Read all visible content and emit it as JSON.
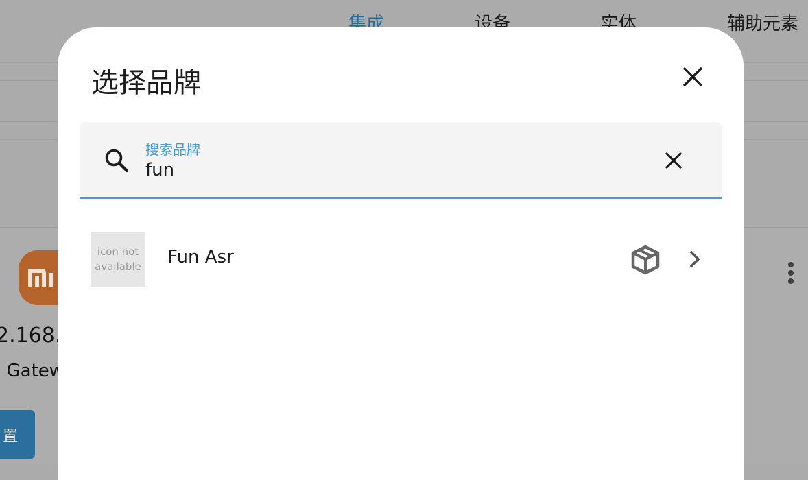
{
  "background": {
    "tabs": [
      {
        "label": "集成",
        "active": true
      },
      {
        "label": "设备",
        "active": false
      },
      {
        "label": "实体",
        "active": false
      },
      {
        "label": "辅助元素",
        "active": false
      }
    ],
    "card": {
      "ip_text": "2.168.",
      "gateway_text": "i Gatew",
      "button_label": "置"
    }
  },
  "dialog": {
    "title": "选择品牌",
    "search": {
      "label": "搜索品牌",
      "value": "fun"
    },
    "results": [
      {
        "logo_text_line1": "icon not",
        "logo_text_line2": "available",
        "name": "Fun Asr",
        "type_icon": "package-variant-icon"
      }
    ]
  },
  "colors": {
    "accent": "#3d9de0",
    "backdrop": "#ababab",
    "surface": "#ffffff",
    "search_field": "#f4f4f4"
  }
}
